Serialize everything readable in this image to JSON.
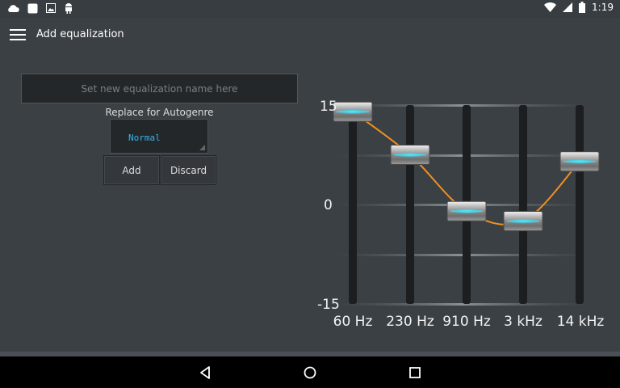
{
  "status_bar": {
    "time": "1:19",
    "left_icons": [
      "cloud-icon",
      "square-icon",
      "image-icon",
      "android-icon"
    ],
    "right_icons": [
      "wifi-icon",
      "signal-icon",
      "battery-icon"
    ]
  },
  "toolbar": {
    "title": "Add equalization",
    "menu_icon": "hamburger-menu-icon"
  },
  "form": {
    "name_placeholder": "Set new equalization name here",
    "name_value": "",
    "autogenre_label": "Replace for Autogenre",
    "autogenre_value": "Normal",
    "add_label": "Add",
    "discard_label": "Discard"
  },
  "equalizer": {
    "y_labels": {
      "top": "15",
      "mid": "0",
      "bottom": "-15"
    },
    "range": [
      -15,
      15
    ],
    "bands": [
      {
        "label": "60 Hz",
        "value": 14
      },
      {
        "label": "230 Hz",
        "value": 7.5
      },
      {
        "label": "910 Hz",
        "value": -1
      },
      {
        "label": "3 kHz",
        "value": -2.5
      },
      {
        "label": "14 kHz",
        "value": 6.5
      }
    ],
    "colors": {
      "curve": "#f09020",
      "track": "#1c1e20",
      "accent": "#4fd8e8"
    }
  },
  "nav_bar": {
    "back_icon": "back-triangle-icon",
    "home_icon": "home-circle-icon",
    "recents_icon": "recents-square-icon"
  }
}
